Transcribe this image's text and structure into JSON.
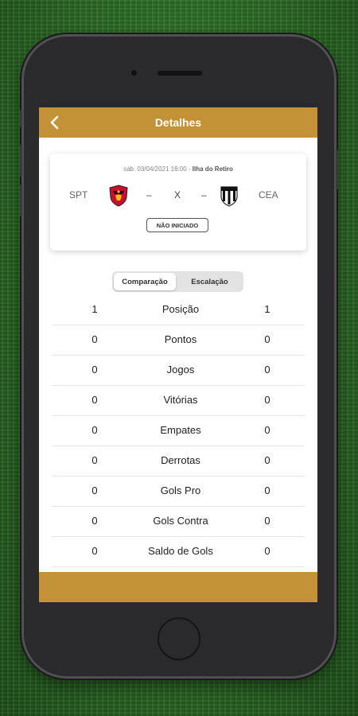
{
  "header": {
    "title": "Detalhes"
  },
  "match": {
    "date": "sáb. 03/04/2021 16:00",
    "separator": " - ",
    "venue": "Ilha do Retiro",
    "home_abbr": "SPT",
    "away_abbr": "CEA",
    "home_crest": "sport-recife-crest",
    "away_crest": "ceara-crest",
    "dash": "–",
    "versus": "X",
    "status": "NÃO INICIADO"
  },
  "tabs": {
    "comparison": "Comparação",
    "lineup": "Escalação",
    "active": "Comparação"
  },
  "stats": [
    {
      "label": "Posição",
      "home": "1",
      "away": "1"
    },
    {
      "label": "Pontos",
      "home": "0",
      "away": "0"
    },
    {
      "label": "Jogos",
      "home": "0",
      "away": "0"
    },
    {
      "label": "Vitórias",
      "home": "0",
      "away": "0"
    },
    {
      "label": "Empates",
      "home": "0",
      "away": "0"
    },
    {
      "label": "Derrotas",
      "home": "0",
      "away": "0"
    },
    {
      "label": "Gols Pro",
      "home": "0",
      "away": "0"
    },
    {
      "label": "Gols Contra",
      "home": "0",
      "away": "0"
    },
    {
      "label": "Saldo de Gols",
      "home": "0",
      "away": "0"
    }
  ],
  "colors": {
    "accent": "#c39236",
    "grass": "#2e6e27",
    "phone": "#2a2a2c"
  }
}
